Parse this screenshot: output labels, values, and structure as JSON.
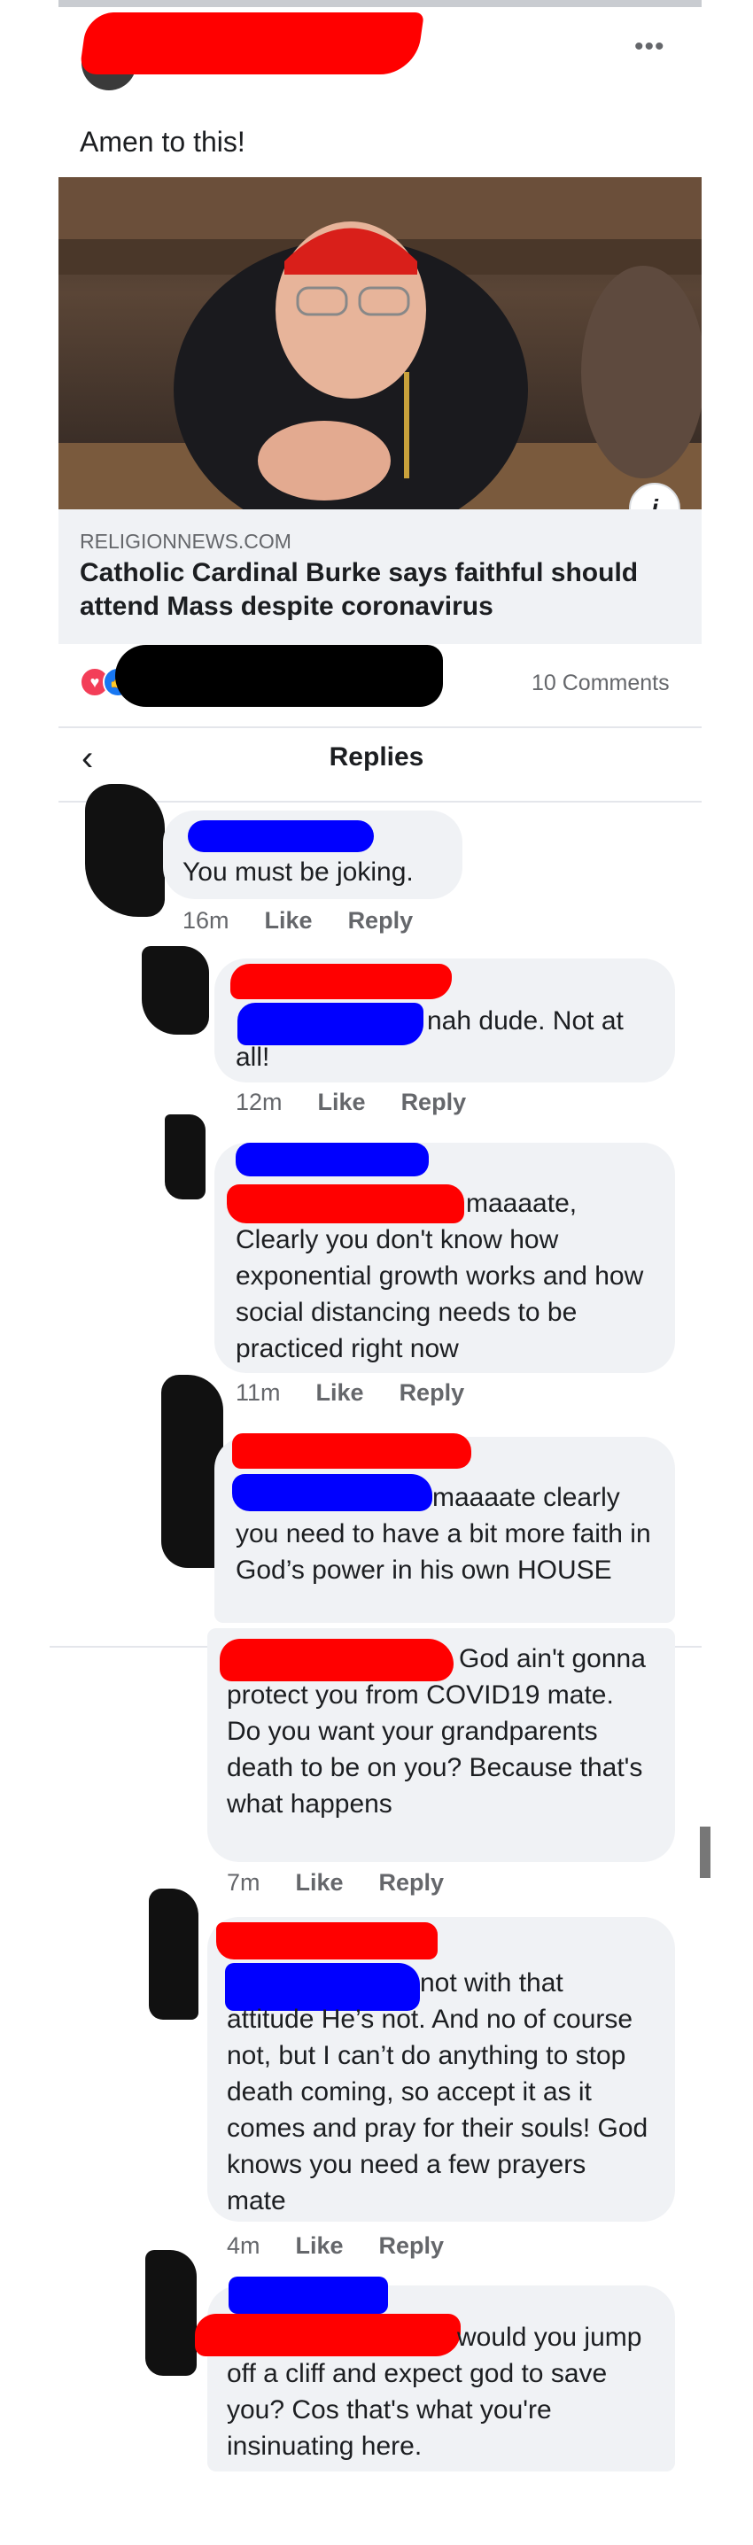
{
  "post": {
    "text": "Amen to this!",
    "more_icon": "more-horizontal-icon",
    "link": {
      "domain": "RELIGIONNEWS.COM",
      "headline": "Catholic Cardinal Burke says faithful should attend Mass despite coronavirus",
      "info_icon": "i"
    },
    "comments_count": "10 Comments",
    "reactions": [
      "love-icon",
      "like-icon"
    ]
  },
  "replies_header": {
    "title": "Replies",
    "back_icon": "chevron-left-icon"
  },
  "comments": [
    {
      "text": "You must be joking.",
      "time": "16m",
      "like": "Like",
      "reply": "Reply"
    },
    {
      "text": "nah dude. Not at all!",
      "time": "12m",
      "like": "Like",
      "reply": "Reply"
    },
    {
      "text": "maaaate, Clearly you don't know how exponential growth works and how social distancing needs to be practiced right now",
      "time": "11m",
      "like": "Like",
      "reply": "Reply"
    },
    {
      "text": "maaaate clearly you need to have a bit more faith in God’s power in his own HOUSE",
      "time": "",
      "like": "",
      "reply": ""
    },
    {
      "text": "God ain't gonna protect you from COVID19 mate. Do you want your grandparents death to be on you? Because that's what happens",
      "time": "7m",
      "like": "Like",
      "reply": "Reply"
    },
    {
      "text": "not with that attitude He’s not. And no of course not, but I can’t do anything to stop death coming, so accept it as it comes and pray for their souls! God knows you need a few prayers mate",
      "time": "4m",
      "like": "Like",
      "reply": "Reply"
    },
    {
      "text": "would you jump off a cliff and expect god to save you? Cos that's what you're insinuating here.",
      "time": "",
      "like": "",
      "reply": ""
    }
  ],
  "colors": {
    "bubble": "#f0f2f5",
    "meta": "#65676b",
    "redact_red": "#ff0000",
    "redact_blue": "#0000ff"
  }
}
